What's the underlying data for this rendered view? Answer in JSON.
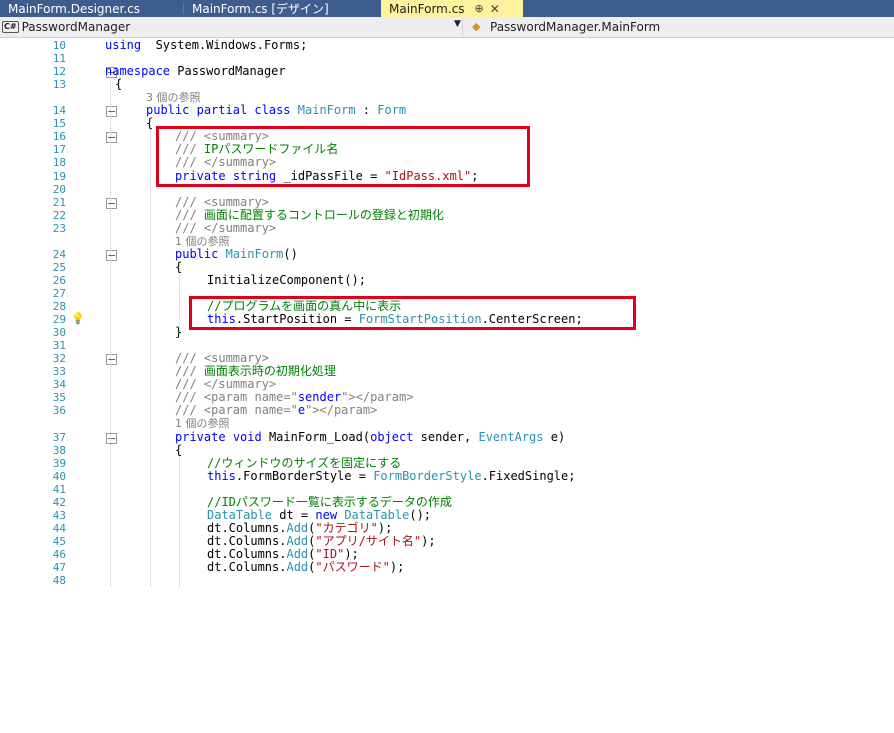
{
  "tabs": [
    {
      "label": "MainForm.Designer.cs",
      "active": false
    },
    {
      "label": "MainForm.cs [デザイン]",
      "active": false
    },
    {
      "label": "MainForm.cs",
      "active": true,
      "pin": "⊕",
      "close": "✕"
    }
  ],
  "nav": {
    "project_badge": "C#",
    "project": "PasswordManager",
    "class_member": "PasswordManager.MainForm"
  },
  "colors": {
    "tab_bar": "#3f5c8e",
    "active_tab": "#fff29d",
    "highlight_box": "#e0001b",
    "line_number": "#2b91af",
    "keyword": "#0000ff",
    "type": "#2b91af",
    "comment": "#008000",
    "string": "#a31515"
  },
  "editor": {
    "lines": [
      {
        "n": "10",
        "segs": [
          [
            "kw",
            "using"
          ],
          [
            "",
            "  System.Windows.Forms;"
          ]
        ]
      },
      {
        "n": "11",
        "segs": []
      },
      {
        "n": "12",
        "segs": [
          [
            "kw",
            "namespace"
          ],
          [
            "",
            " PasswordManager"
          ]
        ]
      },
      {
        "n": "13",
        "segs": [
          [
            "",
            "{"
          ]
        ]
      },
      {
        "n": "",
        "segs": [
          [
            "ref",
            "3 個の参照"
          ]
        ]
      },
      {
        "n": "14",
        "segs": [
          [
            "kw",
            "public"
          ],
          [
            "",
            " "
          ],
          [
            "kw",
            "partial"
          ],
          [
            "",
            " "
          ],
          [
            "kw",
            "class"
          ],
          [
            "",
            " "
          ],
          [
            "ty",
            "MainForm"
          ],
          [
            "",
            " : "
          ],
          [
            "ty",
            "Form"
          ]
        ]
      },
      {
        "n": "15",
        "segs": [
          [
            "",
            "{"
          ]
        ]
      },
      {
        "n": "16",
        "segs": [
          [
            "xml",
            "/// <summary>"
          ]
        ]
      },
      {
        "n": "17",
        "segs": [
          [
            "xml",
            "/// "
          ],
          [
            "cm",
            "IPパスワードファイル名"
          ]
        ]
      },
      {
        "n": "18",
        "segs": [
          [
            "xml",
            "/// </summary>"
          ]
        ]
      },
      {
        "n": "19",
        "segs": [
          [
            "kw",
            "private"
          ],
          [
            "",
            " "
          ],
          [
            "kw",
            "string"
          ],
          [
            "",
            " _idPassFile = "
          ],
          [
            "str",
            "\"IdPass.xml\""
          ],
          [
            "",
            ";"
          ]
        ]
      },
      {
        "n": "20",
        "segs": []
      },
      {
        "n": "21",
        "segs": [
          [
            "xml",
            "/// <summary>"
          ]
        ]
      },
      {
        "n": "22",
        "segs": [
          [
            "xml",
            "/// "
          ],
          [
            "cm",
            "画面に配置するコントロールの登録と初期化"
          ]
        ]
      },
      {
        "n": "23",
        "segs": [
          [
            "xml",
            "/// </summary>"
          ]
        ]
      },
      {
        "n": "",
        "segs": [
          [
            "ref",
            "1 個の参照"
          ]
        ]
      },
      {
        "n": "24",
        "segs": [
          [
            "kw",
            "public"
          ],
          [
            "",
            " "
          ],
          [
            "ty",
            "MainForm"
          ],
          [
            "",
            "()"
          ]
        ]
      },
      {
        "n": "25",
        "segs": [
          [
            "",
            "{"
          ]
        ]
      },
      {
        "n": "26",
        "segs": [
          [
            "",
            "InitializeComponent();"
          ]
        ]
      },
      {
        "n": "27",
        "segs": []
      },
      {
        "n": "28",
        "segs": [
          [
            "cm",
            "//プログラムを画面の真ん中に表示"
          ]
        ]
      },
      {
        "n": "29",
        "segs": [
          [
            "kw",
            "this"
          ],
          [
            "",
            ".StartPosition = "
          ],
          [
            "ty",
            "FormStartPosition"
          ],
          [
            "",
            ".CenterScreen;"
          ]
        ]
      },
      {
        "n": "30",
        "segs": [
          [
            "",
            "}"
          ]
        ]
      },
      {
        "n": "31",
        "segs": []
      },
      {
        "n": "32",
        "segs": [
          [
            "xml",
            "/// <summary>"
          ]
        ]
      },
      {
        "n": "33",
        "segs": [
          [
            "xml",
            "/// "
          ],
          [
            "cm",
            "画面表示時の初期化処理"
          ]
        ]
      },
      {
        "n": "34",
        "segs": [
          [
            "xml",
            "/// </summary>"
          ]
        ]
      },
      {
        "n": "35",
        "segs": [
          [
            "xml",
            "/// <param name=\""
          ],
          [
            "kw",
            "sender"
          ],
          [
            "xml",
            "\"></param>"
          ]
        ]
      },
      {
        "n": "36",
        "segs": [
          [
            "xml",
            "/// <param name=\""
          ],
          [
            "kw",
            "e"
          ],
          [
            "xml",
            "\"></param>"
          ]
        ]
      },
      {
        "n": "",
        "segs": [
          [
            "ref",
            "1 個の参照"
          ]
        ]
      },
      {
        "n": "37",
        "segs": [
          [
            "kw",
            "private"
          ],
          [
            "",
            " "
          ],
          [
            "kw",
            "void"
          ],
          [
            "",
            " MainForm_Load("
          ],
          [
            "kw",
            "object"
          ],
          [
            "",
            " sender, "
          ],
          [
            "ty",
            "EventArgs"
          ],
          [
            "",
            " e)"
          ]
        ]
      },
      {
        "n": "38",
        "segs": [
          [
            "",
            "{"
          ]
        ]
      },
      {
        "n": "39",
        "segs": [
          [
            "cm",
            "//ウィンドウのサイズを固定にする"
          ]
        ]
      },
      {
        "n": "40",
        "segs": [
          [
            "kw",
            "this"
          ],
          [
            "",
            ".FormBorderStyle = "
          ],
          [
            "ty",
            "FormBorderStyle"
          ],
          [
            "",
            ".FixedSingle;"
          ]
        ]
      },
      {
        "n": "41",
        "segs": []
      },
      {
        "n": "42",
        "segs": [
          [
            "cm",
            "//IDパスワード一覧に表示するデータの作成"
          ]
        ]
      },
      {
        "n": "43",
        "segs": [
          [
            "ty",
            "DataTable"
          ],
          [
            "",
            " dt = "
          ],
          [
            "kw",
            "new"
          ],
          [
            "",
            " "
          ],
          [
            "ty",
            "DataTable"
          ],
          [
            "",
            "();"
          ]
        ]
      },
      {
        "n": "44",
        "segs": [
          [
            "",
            "dt.Columns."
          ],
          [
            "ty",
            "Add"
          ],
          [
            "",
            "("
          ],
          [
            "str",
            "\"カテゴリ\""
          ],
          [
            "",
            ");"
          ]
        ]
      },
      {
        "n": "45",
        "segs": [
          [
            "",
            "dt.Columns."
          ],
          [
            "ty",
            "Add"
          ],
          [
            "",
            "("
          ],
          [
            "str",
            "\"アプリ/サイト名\""
          ],
          [
            "",
            ");"
          ]
        ]
      },
      {
        "n": "46",
        "segs": [
          [
            "",
            "dt.Columns."
          ],
          [
            "ty",
            "Add"
          ],
          [
            "",
            "("
          ],
          [
            "str",
            "\"ID\""
          ],
          [
            "",
            ");"
          ]
        ]
      },
      {
        "n": "47",
        "segs": [
          [
            "",
            "dt.Columns."
          ],
          [
            "ty",
            "Add"
          ],
          [
            "",
            "("
          ],
          [
            "str",
            "\"パスワード\""
          ],
          [
            "",
            ");"
          ]
        ]
      },
      {
        "n": "48",
        "segs": []
      }
    ]
  }
}
